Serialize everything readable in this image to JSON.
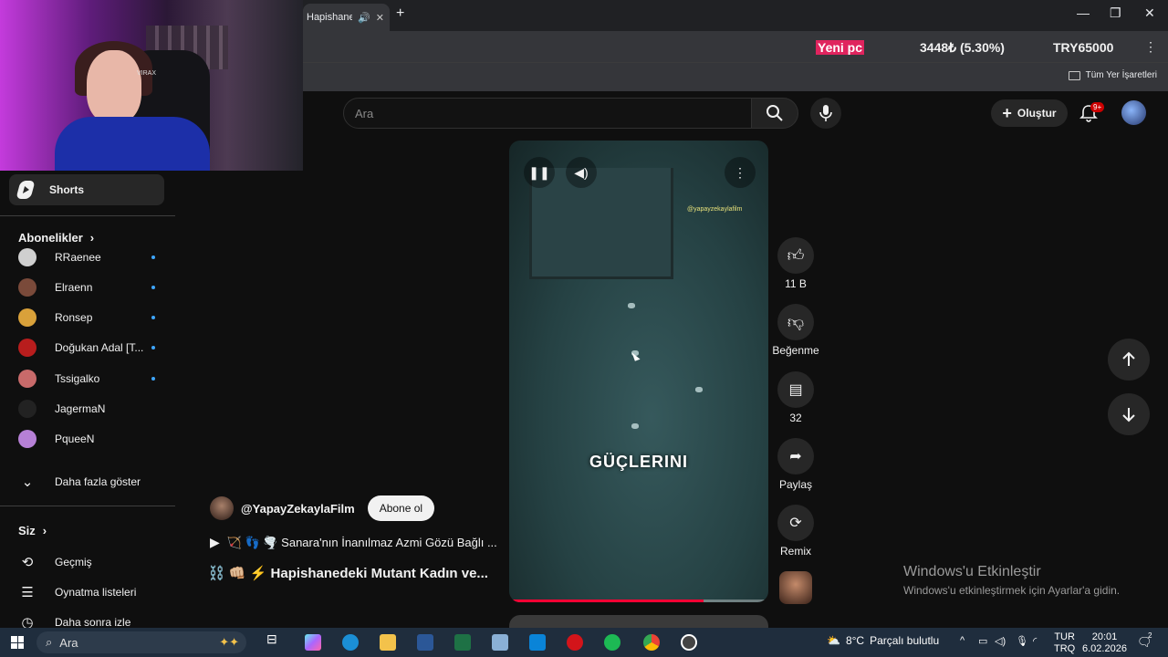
{
  "browser": {
    "tab_title": "Hapishanedeki",
    "new_tab": "+",
    "min": "—",
    "max": "❐",
    "close": "✕",
    "bookmarks_label": "Tüm Yer İşaretleri"
  },
  "ticker": {
    "label": "Yeni pc",
    "value": "3448₺ (5.30%)",
    "goal": "TRY65000"
  },
  "webcam": {
    "chair_brand": "VIRAX"
  },
  "sidebar": {
    "shorts": "Shorts",
    "subscriptions_heading": "Abonelikler",
    "subscriptions": [
      {
        "name": "RRaenee",
        "color": "#cfcfcf"
      },
      {
        "name": "Elraenn",
        "color": "#7a4a3a"
      },
      {
        "name": "Ronsep",
        "color": "#d9a13a"
      },
      {
        "name": "Doğukan Adal [T...",
        "color": "#b81d1d"
      },
      {
        "name": "Tssigalko",
        "color": "#c86a6a"
      },
      {
        "name": "JagermaN",
        "color": "#222222"
      },
      {
        "name": "PqueeN",
        "color": "#b680d6"
      }
    ],
    "show_more": "Daha fazla göster",
    "you_heading": "Siz",
    "history": "Geçmiş",
    "playlists": "Oynatma listeleri",
    "watch_later": "Daha sonra izle"
  },
  "header": {
    "search_placeholder": "Ara",
    "create": "Oluştur",
    "notifications": "9+"
  },
  "video": {
    "caption": "GÜÇLERINI",
    "watermark": "@yapayzekaylafilm",
    "progress": 0.75
  },
  "actions": {
    "likes": "11 B",
    "dislike": "Beğenme",
    "comments": "32",
    "share": "Paylaş",
    "remix": "Remix"
  },
  "meta": {
    "channel": "@YapayZekaylaFilm",
    "subscribe": "Abone ol",
    "playlist_line": "🏹 👣 🌪️ Sanara'nın İnanılmaz Azmi Gözü Bağlı ...",
    "title": "⛓️ 👊🏼 ⚡ Hapishanedeki Mutant Kadın ve..."
  },
  "activation": {
    "title": "Windows'u Etkinleştir",
    "subtitle": "Windows'u etkinleştirmek için Ayarlar'a gidin."
  },
  "taskbar": {
    "search": "Ara",
    "weather": "8°C",
    "weather_desc": "Parçalı bulutlu",
    "lang1": "TUR",
    "lang2": "TRQ",
    "time": "20:01",
    "date": "6.02.2026",
    "notif_count": "2"
  }
}
